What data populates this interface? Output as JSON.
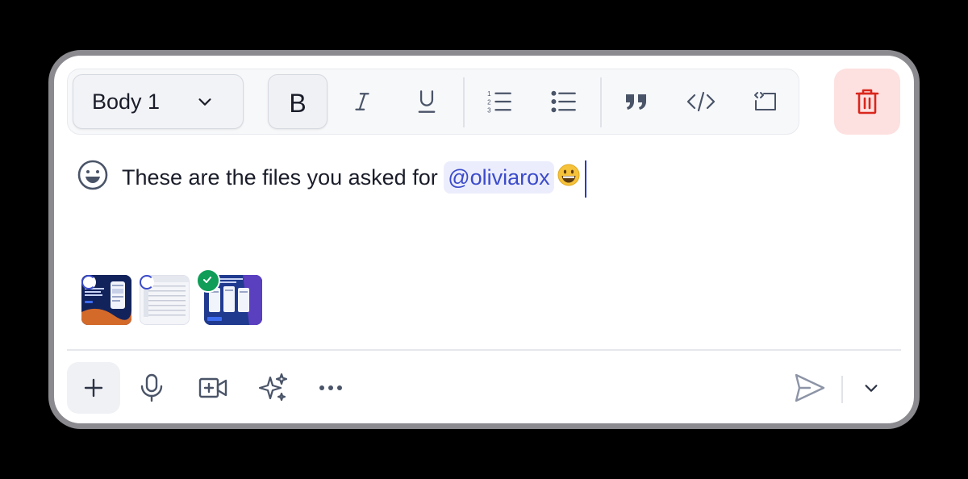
{
  "toolbar": {
    "text_style": "Body 1",
    "bold_label": "B",
    "buttons": [
      "bold",
      "italic",
      "underline",
      "numbered-list",
      "bulleted-list",
      "quote",
      "code",
      "embed"
    ]
  },
  "message": {
    "text": "These are the files you asked for ",
    "mention": "@oliviarox"
  },
  "attachments": [
    {
      "name": "attachment-1",
      "status": "uploading"
    },
    {
      "name": "attachment-2",
      "status": "uploading"
    },
    {
      "name": "attachment-3",
      "status": "uploaded"
    }
  ],
  "colors": {
    "accent": "#3b4bcb",
    "danger": "#d9261c",
    "danger_bg": "#fde0e0",
    "success": "#0f9d58",
    "icon": "#4a5468"
  },
  "icons": [
    "chevron-down-icon",
    "italic-icon",
    "underline-icon",
    "numbered-list-icon",
    "bulleted-list-icon",
    "quote-icon",
    "code-icon",
    "embed-icon",
    "trash-icon",
    "emoji-icon",
    "plus-icon",
    "microphone-icon",
    "video-icon",
    "sparkles-icon",
    "more-icon",
    "send-icon"
  ]
}
